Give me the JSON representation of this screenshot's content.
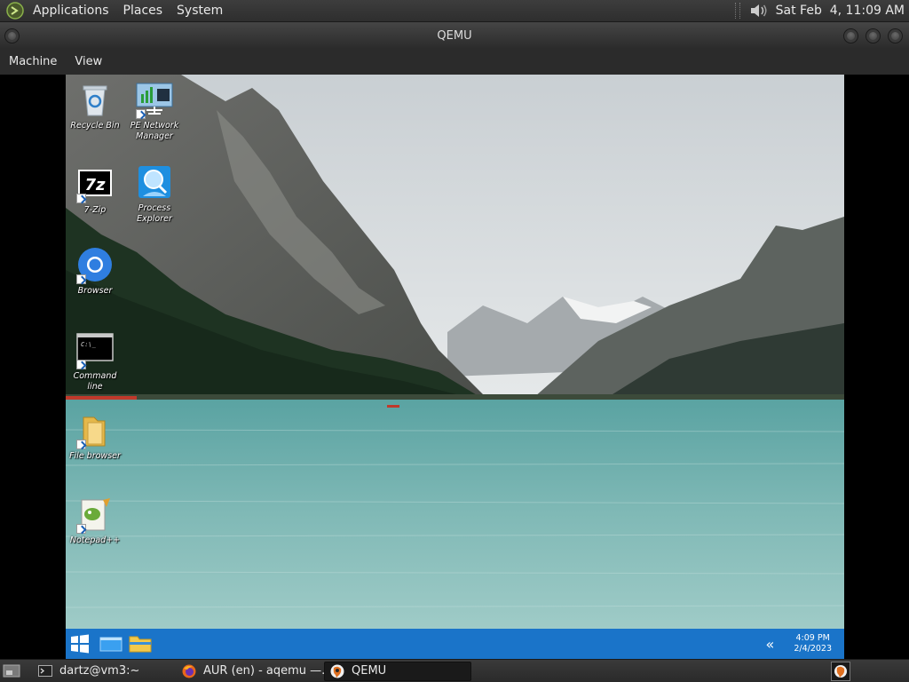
{
  "top_panel": {
    "menus": [
      "Applications",
      "Places",
      "System"
    ],
    "clock": "Sat Feb  4, 11:09 AM"
  },
  "qemu": {
    "title": "QEMU",
    "menu": [
      "Machine",
      "View"
    ]
  },
  "desktop": {
    "icons": [
      {
        "label": "Recycle Bin",
        "icon": "recycle-bin-icon"
      },
      {
        "label": "PE Network Manager",
        "icon": "network-manager-icon"
      },
      {
        "label": "7-Zip",
        "icon": "7zip-icon"
      },
      {
        "label": "Process Explorer",
        "icon": "process-explorer-icon"
      },
      {
        "label": "Browser",
        "icon": "browser-icon"
      },
      {
        "label": "Command line",
        "icon": "command-line-icon"
      },
      {
        "label": "File browser",
        "icon": "folder-icon"
      },
      {
        "label": "Notepad++",
        "icon": "notepad-icon"
      }
    ],
    "cmd_icon_text": "C:\\_"
  },
  "win_taskbar": {
    "time": "4:09 PM",
    "date": "2/4/2023",
    "tray_chevron": "«"
  },
  "bottom_panel": {
    "tasks": [
      {
        "label": "dartz@vm3:~",
        "icon": "terminal-icon"
      },
      {
        "label": "AUR (en) - aqemu —...",
        "icon": "firefox-icon"
      },
      {
        "label": "QEMU",
        "icon": "qemu-icon"
      }
    ]
  },
  "colors": {
    "panel": "#2e2e2e",
    "win_taskbar": "#1a74c9",
    "lake": "#7fb8b5",
    "sky": "#d9dee0"
  }
}
